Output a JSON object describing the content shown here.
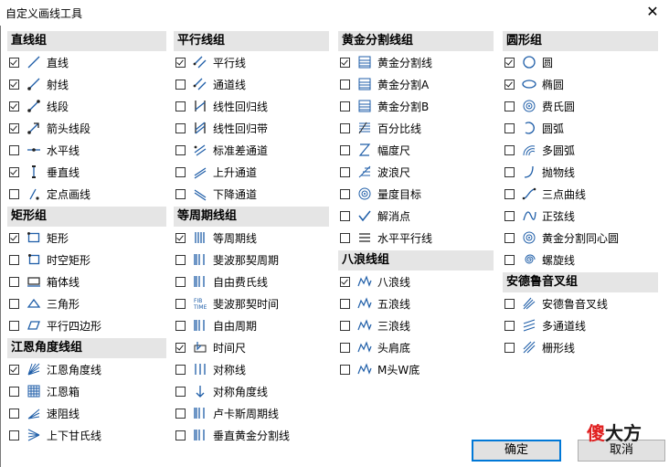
{
  "window": {
    "title": "自定义画线工具",
    "close_glyph": "✕"
  },
  "groups": [
    {
      "id": "line",
      "title": "直线组",
      "items": [
        {
          "label": "直线",
          "checked": true,
          "icon": "line"
        },
        {
          "label": "射线",
          "checked": true,
          "icon": "ray"
        },
        {
          "label": "线段",
          "checked": true,
          "icon": "segment"
        },
        {
          "label": "箭头线段",
          "checked": true,
          "icon": "arrow"
        },
        {
          "label": "水平线",
          "checked": false,
          "icon": "hline"
        },
        {
          "label": "垂直线",
          "checked": true,
          "icon": "vline"
        },
        {
          "label": "定点画线",
          "checked": false,
          "icon": "fixed"
        }
      ]
    },
    {
      "id": "rect",
      "title": "矩形组",
      "items": [
        {
          "label": "矩形",
          "checked": true,
          "icon": "rect"
        },
        {
          "label": "时空矩形",
          "checked": false,
          "icon": "rect2"
        },
        {
          "label": "箱体线",
          "checked": false,
          "icon": "box"
        },
        {
          "label": "三角形",
          "checked": false,
          "icon": "tri"
        },
        {
          "label": "平行四边形",
          "checked": false,
          "icon": "para"
        }
      ]
    },
    {
      "id": "gann",
      "title": "江恩角度线组",
      "items": [
        {
          "label": "江恩角度线",
          "checked": true,
          "icon": "fan"
        },
        {
          "label": "江恩箱",
          "checked": false,
          "icon": "grid"
        },
        {
          "label": "速阻线",
          "checked": false,
          "icon": "fan2"
        },
        {
          "label": "上下甘氏线",
          "checked": false,
          "icon": "fan3"
        }
      ]
    },
    {
      "id": "parallel",
      "title": "平行线组",
      "items": [
        {
          "label": "平行线",
          "checked": true,
          "icon": "par"
        },
        {
          "label": "通道线",
          "checked": false,
          "icon": "par"
        },
        {
          "label": "线性回归线",
          "checked": false,
          "icon": "reg"
        },
        {
          "label": "线性回归带",
          "checked": false,
          "icon": "regband"
        },
        {
          "label": "标准差通道",
          "checked": false,
          "icon": "stdch"
        },
        {
          "label": "上升通道",
          "checked": false,
          "icon": "up"
        },
        {
          "label": "下降通道",
          "checked": false,
          "icon": "down"
        }
      ]
    },
    {
      "id": "period",
      "title": "等周期线组",
      "items": [
        {
          "label": "等周期线",
          "checked": true,
          "icon": "vbars"
        },
        {
          "label": "斐波那契周期",
          "checked": false,
          "icon": "vbars2"
        },
        {
          "label": "自由费氏线",
          "checked": false,
          "icon": "vbars2"
        },
        {
          "label": "斐波那契时间",
          "checked": false,
          "icon": "fibtime"
        },
        {
          "label": "自由周期",
          "checked": false,
          "icon": "vbars2"
        },
        {
          "label": "时间尺",
          "checked": true,
          "icon": "ruler"
        },
        {
          "label": "对称线",
          "checked": false,
          "icon": "vbars3"
        },
        {
          "label": "对称角度线",
          "checked": false,
          "icon": "sym"
        },
        {
          "label": "卢卡斯周期线",
          "checked": false,
          "icon": "vbars2"
        },
        {
          "label": "垂直黄金分割线",
          "checked": false,
          "icon": "vbars2"
        }
      ]
    },
    {
      "id": "golden",
      "title": "黄金分割线组",
      "items": [
        {
          "label": "黄金分割线",
          "checked": true,
          "icon": "gold"
        },
        {
          "label": "黄金分割A",
          "checked": false,
          "icon": "gold"
        },
        {
          "label": "黄金分割B",
          "checked": false,
          "icon": "gold"
        },
        {
          "label": "百分比线",
          "checked": false,
          "icon": "pct"
        },
        {
          "label": "幅度尺",
          "checked": false,
          "icon": "amp"
        },
        {
          "label": "波浪尺",
          "checked": false,
          "icon": "wave"
        },
        {
          "label": "量度目标",
          "checked": false,
          "icon": "target"
        },
        {
          "label": "解消点",
          "checked": false,
          "icon": "check"
        },
        {
          "label": "水平平行线",
          "checked": false,
          "icon": "hlines"
        }
      ]
    },
    {
      "id": "wave",
      "title": "八浪线组",
      "items": [
        {
          "label": "八浪线",
          "checked": true,
          "icon": "zig"
        },
        {
          "label": "五浪线",
          "checked": false,
          "icon": "zig"
        },
        {
          "label": "三浪线",
          "checked": false,
          "icon": "zig"
        },
        {
          "label": "头肩底",
          "checked": false,
          "icon": "zig"
        },
        {
          "label": "M头W底",
          "checked": false,
          "icon": "zig"
        }
      ]
    },
    {
      "id": "circle",
      "title": "圆形组",
      "items": [
        {
          "label": "圆",
          "checked": true,
          "icon": "circle"
        },
        {
          "label": "椭圆",
          "checked": true,
          "icon": "ellipse"
        },
        {
          "label": "费氏圆",
          "checked": false,
          "icon": "target"
        },
        {
          "label": "圆弧",
          "checked": false,
          "icon": "arc"
        },
        {
          "label": "多圆弧",
          "checked": false,
          "icon": "arcs"
        },
        {
          "label": "抛物线",
          "checked": false,
          "icon": "parab"
        },
        {
          "label": "三点曲线",
          "checked": false,
          "icon": "curve"
        },
        {
          "label": "正弦线",
          "checked": false,
          "icon": "sine"
        },
        {
          "label": "黄金分割同心圆",
          "checked": false,
          "icon": "target"
        },
        {
          "label": "螺旋线",
          "checked": false,
          "icon": "spiral"
        }
      ]
    },
    {
      "id": "andrews",
      "title": "安德鲁音叉组",
      "items": [
        {
          "label": "安德鲁音叉线",
          "checked": false,
          "icon": "fork"
        },
        {
          "label": "多通道线",
          "checked": false,
          "icon": "fork2"
        },
        {
          "label": "栅形线",
          "checked": false,
          "icon": "hatch"
        }
      ]
    }
  ],
  "buttons": {
    "ok": "确定",
    "cancel": "取消"
  },
  "watermark": {
    "a": "傻",
    "b": "大方"
  }
}
